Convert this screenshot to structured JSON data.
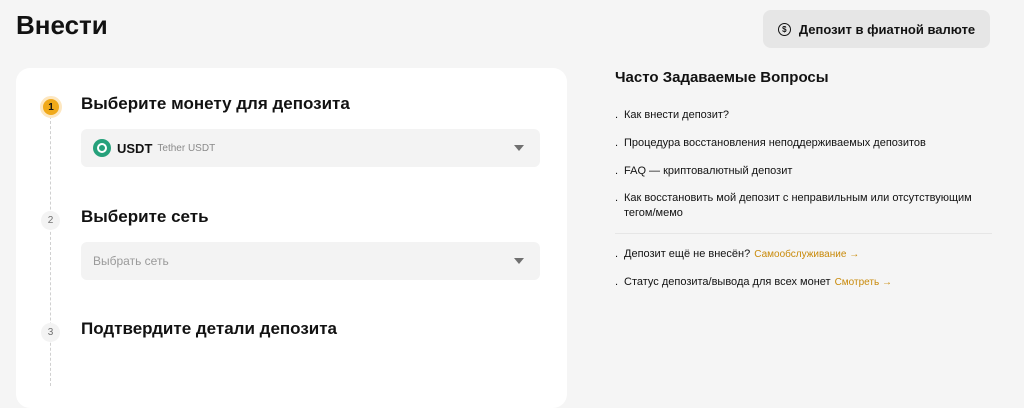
{
  "header": {
    "title": "Внести",
    "fiat_button_label": "Депозит в фиатной валюте",
    "fiat_button_icon": "coin-icon"
  },
  "steps": [
    {
      "number": "1",
      "title": "Выберите монету для депозита",
      "state": "active"
    },
    {
      "number": "2",
      "title": "Выберите сеть",
      "state": "inactive"
    },
    {
      "number": "3",
      "title": "Подтвердите детали депозита",
      "state": "inactive"
    }
  ],
  "coin_select": {
    "symbol": "USDT",
    "name": "Tether USDT",
    "icon": "tether-icon"
  },
  "network_select": {
    "placeholder": "Выбрать сеть"
  },
  "faq": {
    "title": "Часто Задаваемые Вопросы",
    "items": [
      "Как внести депозит?",
      "Процедура восстановления неподдерживаемых депозитов",
      "FAQ — криптовалютный депозит",
      "Как восстановить мой депозит с неправильным или отсутствующим тегом/мемо"
    ],
    "extra": [
      {
        "text": "Депозит ещё не внесён?",
        "link": "Самообслуживание →"
      },
      {
        "text": "Статус депозита/вывода для всех монет",
        "link": "Смотреть →"
      }
    ]
  },
  "colors": {
    "accent": "#f0a91a",
    "link": "#c98a0a",
    "tether": "#26a17b"
  }
}
